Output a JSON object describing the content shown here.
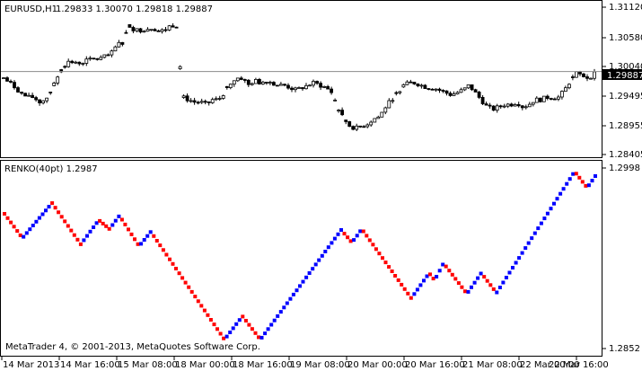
{
  "main_chart": {
    "symbol_label": "EURUSD,H1",
    "ohlc_label": "1.29833 1.30070 1.29818 1.29887",
    "current_price_label": "1.29887",
    "current_price": 1.29887,
    "y_range": [
      1.2812,
      1.3134
    ],
    "y_ticks": [
      "1.31120",
      "1.30580",
      "1.30040",
      "1.29495",
      "1.28955",
      "1.28405"
    ],
    "candle_count": 165,
    "colors": {
      "bull_body": "#ffffff",
      "bear_body": "#000000",
      "outline": "#000000",
      "price_line": "#8c8c8c",
      "price_box": "#000000",
      "price_text": "#ffffff"
    }
  },
  "renko_panel": {
    "indicator_label": "RENKO(40pt) 1.2987",
    "y_ticks": [
      "1.2998",
      "1.2852"
    ],
    "box_count": 187,
    "up_color": "#0000ff",
    "down_color": "#ff0000"
  },
  "x_axis": {
    "labels": [
      "14 Mar 2013",
      "14 Mar 16:00",
      "15 Mar 08:00",
      "18 Mar 00:00",
      "18 Mar 16:00",
      "19 Mar 08:00",
      "20 Mar 00:00",
      "20 Mar 16:00",
      "21 Mar 08:00",
      "22 Mar 00:00",
      "22 Mar 16:00"
    ]
  },
  "footer": {
    "copyright": "MetaTrader 4, © 2001-2013, MetaQuotes Software Corp."
  },
  "chart_data": [
    {
      "type": "candlestick",
      "title": "EURUSD,H1",
      "ylim": [
        1.2812,
        1.3134
      ],
      "x_tick_labels": [
        "14 Mar 2013",
        "14 Mar 16:00",
        "15 Mar 08:00",
        "18 Mar 00:00",
        "18 Mar 16:00",
        "19 Mar 08:00",
        "20 Mar 00:00",
        "20 Mar 16:00",
        "21 Mar 08:00",
        "22 Mar 00:00",
        "22 Mar 16:00"
      ],
      "y_tick_labels": [
        "1.31120",
        "1.30580",
        "1.30040",
        "1.29495",
        "1.28955",
        "1.28405"
      ],
      "path_levels": [
        1.2975,
        1.2965,
        1.2955,
        1.2942,
        1.2935,
        1.2935,
        1.2925,
        1.293,
        1.295,
        1.2975,
        1.3,
        1.301,
        1.3005,
        1.3008,
        1.3012,
        1.3015,
        1.3015,
        1.302,
        1.3025,
        1.3045,
        1.305,
        1.3085,
        1.3075,
        1.3075,
        1.3078,
        1.308,
        1.3072,
        1.3075,
        1.3085,
        1.3085,
        1.2935,
        1.293,
        1.2925,
        1.2925,
        1.292,
        1.293,
        1.293,
        1.2945,
        1.2965,
        1.2975,
        1.2975,
        1.296,
        1.297,
        1.2965,
        1.297,
        1.2965,
        1.296,
        1.296,
        1.2955,
        1.295,
        1.2955,
        1.296,
        1.2965,
        1.296,
        1.2955,
        1.2945,
        1.2915,
        1.289,
        1.2875,
        1.287,
        1.2875,
        1.288,
        1.289,
        1.2895,
        1.2915,
        1.293,
        1.2945,
        1.296,
        1.2965,
        1.2965,
        1.296,
        1.2955,
        1.2955,
        1.295,
        1.2945,
        1.294,
        1.2945,
        1.295,
        1.296,
        1.2945,
        1.293,
        1.2915,
        1.291,
        1.2915,
        1.292,
        1.292,
        1.2925,
        1.2915,
        1.292,
        1.293,
        1.293,
        1.2935,
        1.2935,
        1.2935,
        1.295,
        1.297,
        1.2985,
        1.298,
        1.2975,
        1.2985
      ],
      "current_price": 1.29887
    },
    {
      "type": "renko",
      "title": "RENKO(40pt) 1.2987",
      "box_size_points": 40,
      "ylim": [
        1.2852,
        1.2998
      ],
      "last_value": 1.2987,
      "series": [
        {
          "name": "up",
          "color": "#0000ff"
        },
        {
          "name": "down",
          "color": "#ff0000"
        }
      ],
      "waypoints": [
        {
          "x": 5,
          "y": 238
        },
        {
          "x": 25,
          "y": 265
        },
        {
          "x": 58,
          "y": 226
        },
        {
          "x": 90,
          "y": 272
        },
        {
          "x": 110,
          "y": 245
        },
        {
          "x": 122,
          "y": 255
        },
        {
          "x": 133,
          "y": 240
        },
        {
          "x": 155,
          "y": 274
        },
        {
          "x": 168,
          "y": 258
        },
        {
          "x": 250,
          "y": 378
        },
        {
          "x": 270,
          "y": 352
        },
        {
          "x": 290,
          "y": 378
        },
        {
          "x": 380,
          "y": 256
        },
        {
          "x": 392,
          "y": 270
        },
        {
          "x": 403,
          "y": 255
        },
        {
          "x": 458,
          "y": 332
        },
        {
          "x": 478,
          "y": 304
        },
        {
          "x": 484,
          "y": 312
        },
        {
          "x": 494,
          "y": 293
        },
        {
          "x": 520,
          "y": 327
        },
        {
          "x": 536,
          "y": 304
        },
        {
          "x": 553,
          "y": 326
        },
        {
          "x": 640,
          "y": 191
        },
        {
          "x": 654,
          "y": 209
        },
        {
          "x": 663,
          "y": 196
        }
      ]
    }
  ]
}
